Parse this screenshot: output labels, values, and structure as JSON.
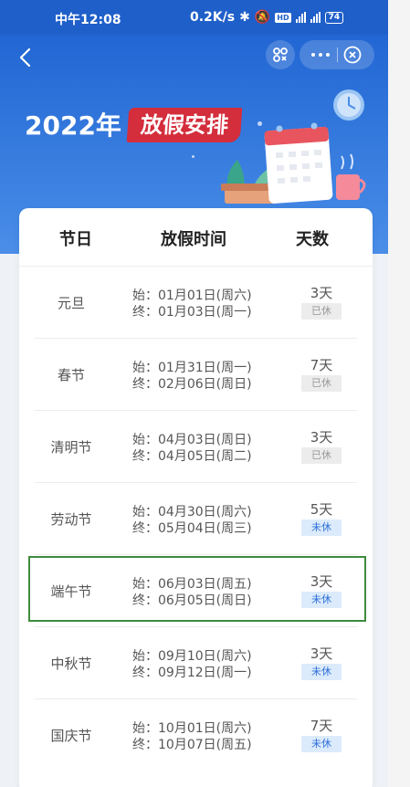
{
  "status_bar": {
    "time": "中午12:08",
    "speed": "0.2K/s",
    "battery": "74"
  },
  "header": {
    "year": "2022年",
    "title": "放假安排"
  },
  "table": {
    "headers": [
      "节日",
      "放假时间",
      "天数"
    ],
    "rows": [
      {
        "name": "元旦",
        "start": "始：01月01日(周六)",
        "end": "终：01月03日(周一)",
        "days": "3天",
        "status": "已休",
        "rested": true
      },
      {
        "name": "春节",
        "start": "始：01月31日(周一)",
        "end": "终：02月06日(周日)",
        "days": "7天",
        "status": "已休",
        "rested": true
      },
      {
        "name": "清明节",
        "start": "始：04月03日(周日)",
        "end": "终：04月05日(周二)",
        "days": "3天",
        "status": "已休",
        "rested": true
      },
      {
        "name": "劳动节",
        "start": "始：04月30日(周六)",
        "end": "终：05月04日(周三)",
        "days": "5天",
        "status": "未休",
        "rested": false
      },
      {
        "name": "端午节",
        "start": "始：06月03日(周五)",
        "end": "终：06月05日(周日)",
        "days": "3天",
        "status": "未休",
        "rested": false
      },
      {
        "name": "中秋节",
        "start": "始：09月10日(周六)",
        "end": "终：09月12日(周一)",
        "days": "3天",
        "status": "未休",
        "rested": false
      },
      {
        "name": "国庆节",
        "start": "始：10月01日(周六)",
        "end": "终：10月07日(周五)",
        "days": "7天",
        "status": "未休",
        "rested": false
      }
    ]
  },
  "colors": {
    "header_blue": "#2166d3",
    "badge_red": "#d42d3c",
    "pending_blue": "#2d6fd6",
    "highlight_green": "#3d8b3d"
  },
  "icons": [
    "back-icon",
    "scan-icon",
    "more-icon",
    "close-icon"
  ]
}
